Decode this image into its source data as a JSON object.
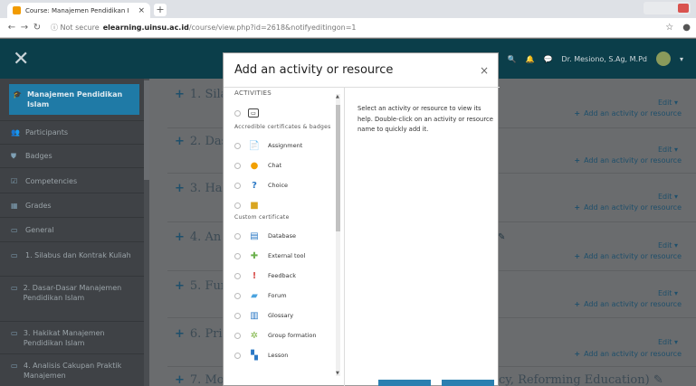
{
  "browser": {
    "tab_title": "Course: Manajemen Pendidikan I",
    "tab_close": "×",
    "new_tab": "+",
    "not_secure": "ⓘ Not secure",
    "url_host": "elearning.uinsu.ac.id",
    "url_path": "/course/view.php?id=2618&notifyeditingon=1"
  },
  "navbar": {
    "user_name": "Dr. Mesiono, S.Ag, M.Pd"
  },
  "sidebar": {
    "items": [
      {
        "label": "Manajemen Pendidikan Islam",
        "icon": "graduation-cap"
      },
      {
        "label": "Participants",
        "icon": "users"
      },
      {
        "label": "Badges",
        "icon": "shield"
      },
      {
        "label": "Competencies",
        "icon": "check-square"
      },
      {
        "label": "Grades",
        "icon": "table"
      },
      {
        "label": "General",
        "icon": "folder"
      },
      {
        "label": "1. Silabus dan Kontrak Kuliah",
        "icon": "folder"
      },
      {
        "label": "2. Dasar-Dasar Manajemen Pendidikan Islam",
        "icon": "folder"
      },
      {
        "label": "3. Hakikat Manajemen Pendidikan Islam",
        "icon": "folder"
      },
      {
        "label": "4. Analisis Cakupan Praktik Manajemen",
        "icon": "folder"
      }
    ]
  },
  "main": {
    "sections": [
      "1. Sila",
      "2. Das",
      "3. Hal",
      "4. An",
      "5. Fur",
      "6. Pri",
      "7. Mo"
    ],
    "section7_tail": "cy, Reforming Education)",
    "edit_label": "Edit ▾",
    "add_label": "Add an activity or resource"
  },
  "modal": {
    "title": "Add an activity or resource",
    "close": "×",
    "top_category": "ACTIVITIES",
    "help_text": "Select an activity or resource to view its help. Double-click on an activity or resource name to quickly add it.",
    "rows": [
      {
        "name": "",
        "icon": "certificate-icon",
        "category_below": "Accredible certificates & badges"
      },
      {
        "name": "Assignment",
        "icon": "assignment-icon"
      },
      {
        "name": "Chat",
        "icon": "chat-icon"
      },
      {
        "name": "Choice",
        "icon": "choice-icon"
      },
      {
        "name": "",
        "icon": "custom-certificate-icon",
        "category_below": "Custom certificate"
      },
      {
        "name": "Database",
        "icon": "database-icon"
      },
      {
        "name": "External tool",
        "icon": "puzzle-icon"
      },
      {
        "name": "Feedback",
        "icon": "feedback-icon"
      },
      {
        "name": "Forum",
        "icon": "forum-icon"
      },
      {
        "name": "Glossary",
        "icon": "glossary-icon"
      },
      {
        "name": "Group formation",
        "icon": "group-formation-icon"
      },
      {
        "name": "Lesson",
        "icon": "lesson-icon"
      }
    ]
  },
  "colors": {
    "navbar": "#0b3e4a",
    "sidebar_active": "#1f7aa6",
    "modal_bg": "#ffffff",
    "link": "#1e4f6b"
  }
}
